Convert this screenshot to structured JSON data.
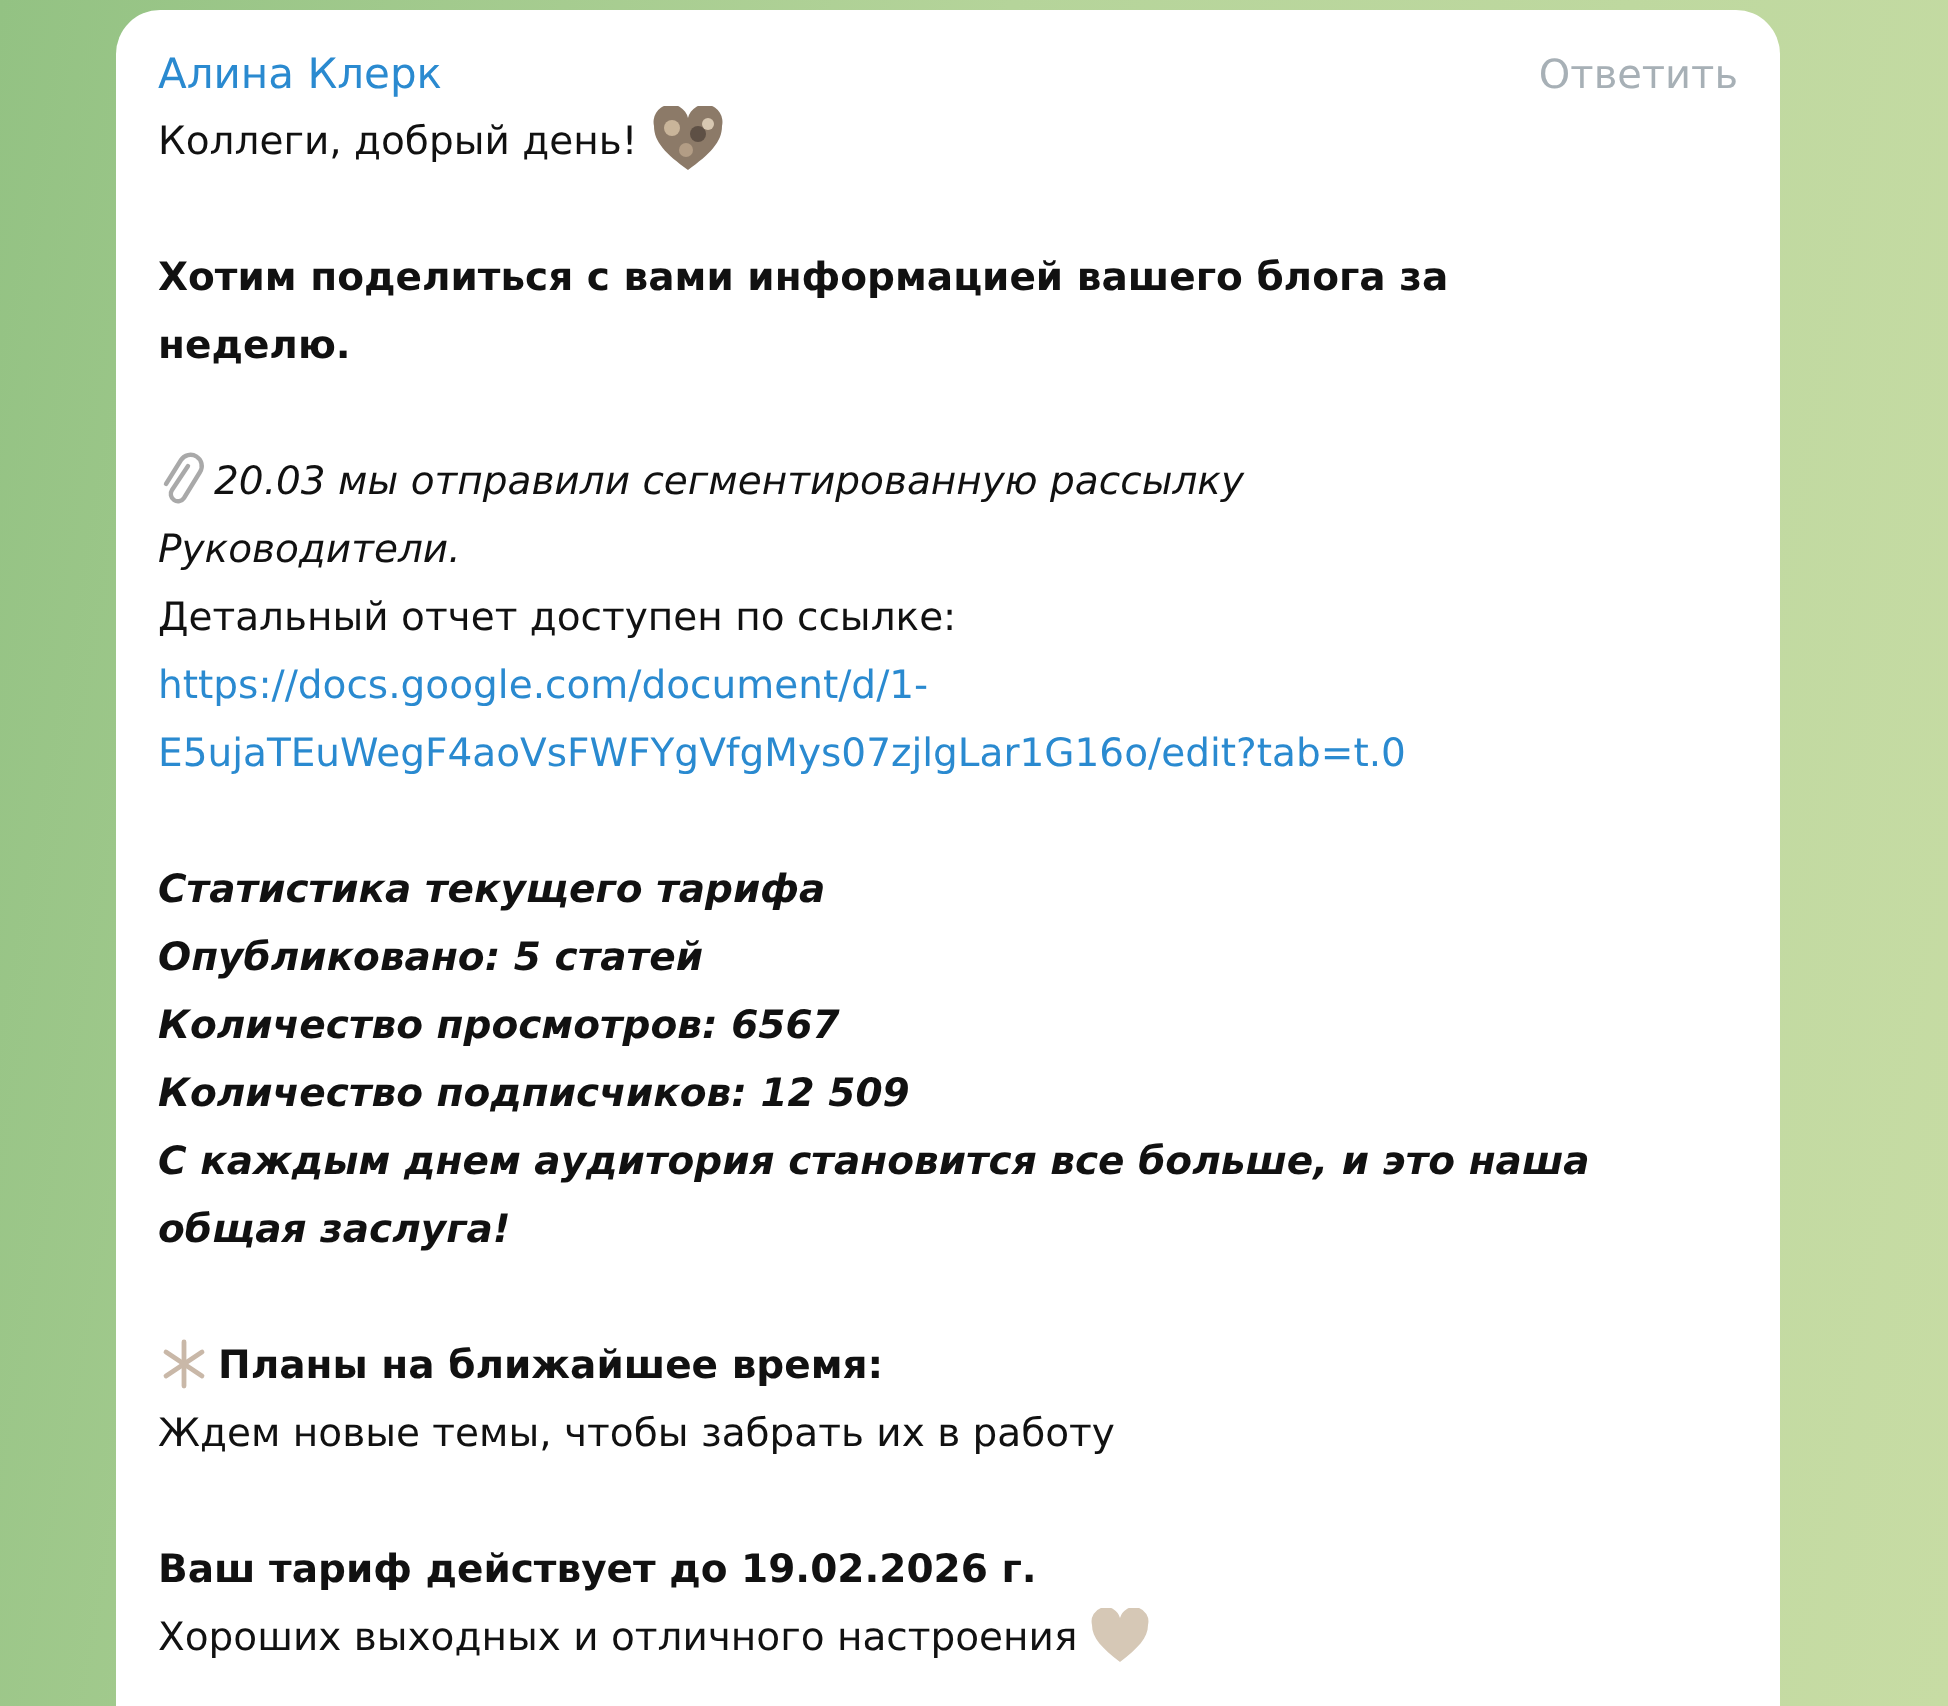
{
  "message": {
    "sender": "Алина Клерк",
    "reply_label": "Ответить",
    "paragraphs": [
      {
        "lines": [
          {
            "kind": "plain",
            "text": "Коллеги, добрый день!"
          }
        ]
      },
      {
        "lines": [
          {
            "kind": "bold",
            "text": "Хотим поделиться с вами информацией вашего блога за"
          },
          {
            "kind": "bold",
            "text": "неделю."
          }
        ]
      },
      {
        "lines": [
          {
            "kind": "italic",
            "text": "20.03 мы отправили сегментированную рассылку"
          },
          {
            "kind": "italic",
            "text": "Руководители."
          },
          {
            "kind": "plain",
            "text": "Детальный отчет доступен по ссылке:"
          },
          {
            "kind": "link",
            "text": "https://docs.google.com/document/d/1-"
          },
          {
            "kind": "link",
            "text": "E5ujaTEuWegF4aoVsFWFYgVfgMys07zjlgLar1G16o/edit?tab=t.0"
          }
        ]
      },
      {
        "lines": [
          {
            "kind": "bold-italic",
            "text": "Статистика текущего тарифа"
          },
          {
            "kind": "bold-italic",
            "text": "Опубликовано: 5 статей"
          },
          {
            "kind": "bold-italic",
            "text": "Количество просмотров: 6567"
          },
          {
            "kind": "bold-italic",
            "text": "Количество подписчиков: 12 509"
          },
          {
            "kind": "bold-italic",
            "text": "С каждым днем аудитория становится все больше, и это наша"
          },
          {
            "kind": "bold-italic",
            "text": "общая заслуга!"
          }
        ]
      },
      {
        "lines": [
          {
            "kind": "bold",
            "text": "Планы на ближайшее время:"
          },
          {
            "kind": "plain",
            "text": "Ждем новые темы, чтобы забрать их в работу"
          }
        ]
      },
      {
        "lines": [
          {
            "kind": "bold",
            "text": "Ваш тариф действует до 19.02.2026 г."
          },
          {
            "kind": "plain",
            "text": "Хороших выходных и отличного настроения"
          }
        ]
      }
    ]
  }
}
